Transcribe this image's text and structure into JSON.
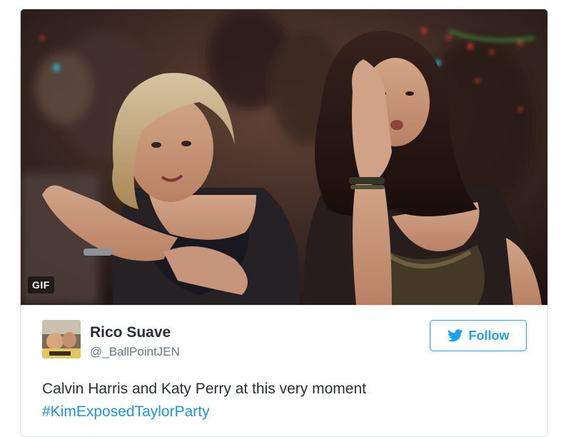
{
  "media": {
    "badge": "GIF",
    "image_subject": "gif-still"
  },
  "author": {
    "display_name": "Rico Suave",
    "handle": "@_BallPointJEN",
    "avatar_icon": "user-avatar"
  },
  "follow_button": {
    "label": "Follow",
    "icon": "twitter-bird-icon",
    "color": "#1da1f2"
  },
  "tweet": {
    "text": "Calvin Harris and Katy Perry at this very moment",
    "hashtag": "#KimExposedTaylorParty",
    "hashtag_color": "#1b95e0"
  }
}
